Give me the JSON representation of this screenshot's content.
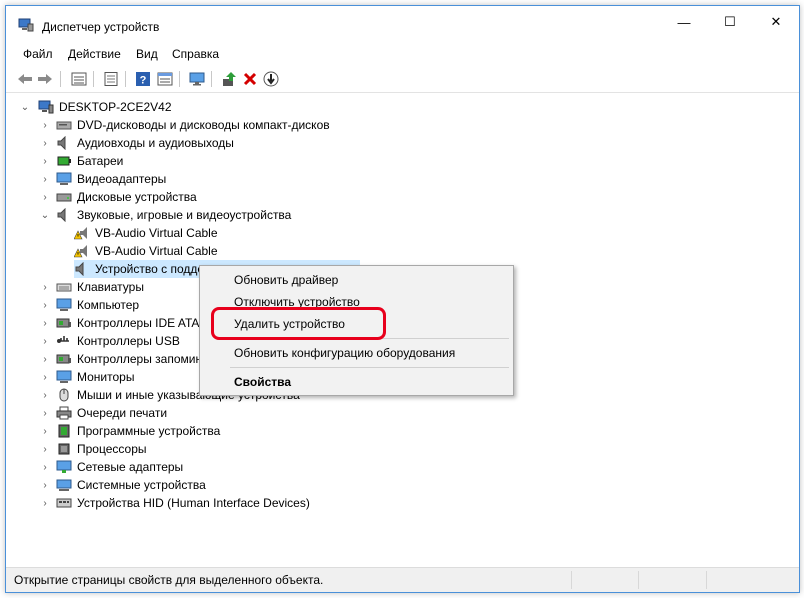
{
  "window": {
    "title": "Диспетчер устройств",
    "minimize": "—",
    "maximize": "☐",
    "close": "✕"
  },
  "menu": [
    "Файл",
    "Действие",
    "Вид",
    "Справка"
  ],
  "tree": {
    "root": "DESKTOP-2CE2V42",
    "categories": [
      "DVD-дисководы и дисководы компакт-дисков",
      "Аудиовходы и аудиовыходы",
      "Батареи",
      "Видеоадаптеры",
      "Дисковые устройства",
      "Звуковые, игровые и видеоустройства",
      "Клавиатуры",
      "Компьютер",
      "Контроллеры IDE ATA/",
      "Контроллеры USB",
      "Контроллеры запомин",
      "Мониторы",
      "Мыши и иные указывающие устройства",
      "Очереди печати",
      "Программные устройства",
      "Процессоры",
      "Сетевые адаптеры",
      "Системные устройства",
      "Устройства HID (Human Interface Devices)"
    ],
    "sound_children": [
      "VB-Audio Virtual Cable",
      "VB-Audio Virtual Cable",
      "Устройство с подде"
    ]
  },
  "context_menu": {
    "update_driver": "Обновить драйвер",
    "disable_device": "Отключить устройство",
    "uninstall_device": "Удалить устройство",
    "scan_hardware": "Обновить конфигурацию оборудования",
    "properties": "Свойства"
  },
  "status": {
    "text": "Открытие страницы свойств для выделенного объекта."
  },
  "colors": {
    "highlight": "#e8001c",
    "selection": "#cce8ff",
    "window_border": "#4a90d9"
  }
}
